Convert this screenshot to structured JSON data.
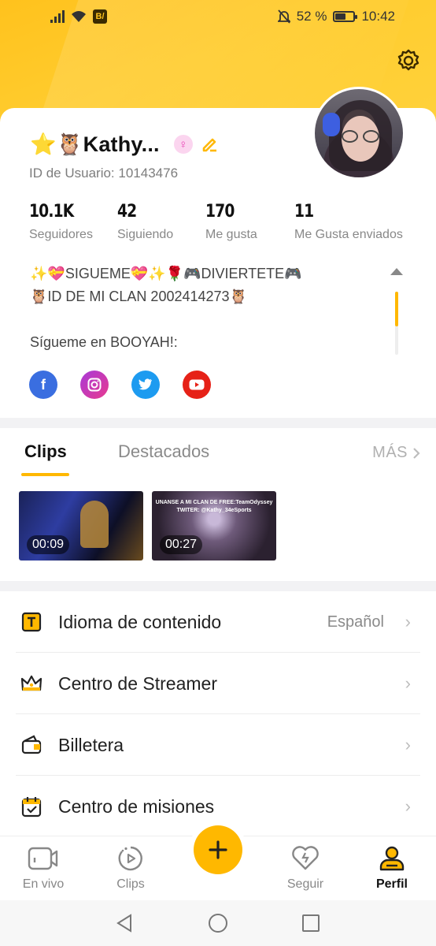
{
  "status_bar": {
    "app_badge": "B/",
    "battery_percent": 52,
    "battery_text": "52 %",
    "time": "10:42"
  },
  "profile": {
    "name": "⭐🦉Kathy...",
    "gender_symbol": "♀",
    "user_id": "ID de Usuario: 10143476",
    "stats": [
      {
        "value": "10.1K",
        "label": "Seguidores"
      },
      {
        "value": "42",
        "label": "Siguiendo"
      },
      {
        "value": "170",
        "label": "Me gusta"
      },
      {
        "value": "11",
        "label": "Me Gusta enviados"
      }
    ],
    "bio_lines": [
      "✨💝SIGUEME💝✨🌹🎮DIVIERTETE🎮",
      "🦉ID DE MI CLAN 2002414273🦉",
      "",
      "Sígueme en BOOYAH!:"
    ],
    "socials": [
      {
        "name": "facebook",
        "glyph": "f"
      },
      {
        "name": "instagram"
      },
      {
        "name": "twitter"
      },
      {
        "name": "youtube"
      }
    ]
  },
  "clips": {
    "tabs": [
      "Clips",
      "Destacados"
    ],
    "active_tab": "Clips",
    "more_label": "MÁS",
    "items": [
      {
        "duration": "00:09"
      },
      {
        "duration": "00:27",
        "caption_line1": "UNANSE A MI CLAN DE FREE:TeamOdyssey",
        "caption_line2": "TWITER: @Kathy_34eSports"
      }
    ]
  },
  "menu": [
    {
      "label": "Idioma de contenido",
      "value": "Español",
      "icon": "language-icon"
    },
    {
      "label": "Centro de Streamer",
      "value": "",
      "icon": "crown-icon"
    },
    {
      "label": "Billetera",
      "value": "",
      "icon": "wallet-icon"
    },
    {
      "label": "Centro de misiones",
      "value": "",
      "icon": "calendar-check-icon"
    }
  ],
  "bottom_nav": [
    {
      "label": "En vivo",
      "icon": "live-camera-icon"
    },
    {
      "label": "Clips",
      "icon": "clips-timer-icon"
    },
    {
      "label": "Seguir",
      "icon": "heart-icon"
    },
    {
      "label": "Perfil",
      "icon": "person-icon",
      "active": true
    }
  ],
  "colors": {
    "accent": "#ffb800",
    "header": "#ffc21d",
    "facebook": "#3a6ee0",
    "twitter": "#1d9bf0",
    "youtube": "#e62117"
  }
}
